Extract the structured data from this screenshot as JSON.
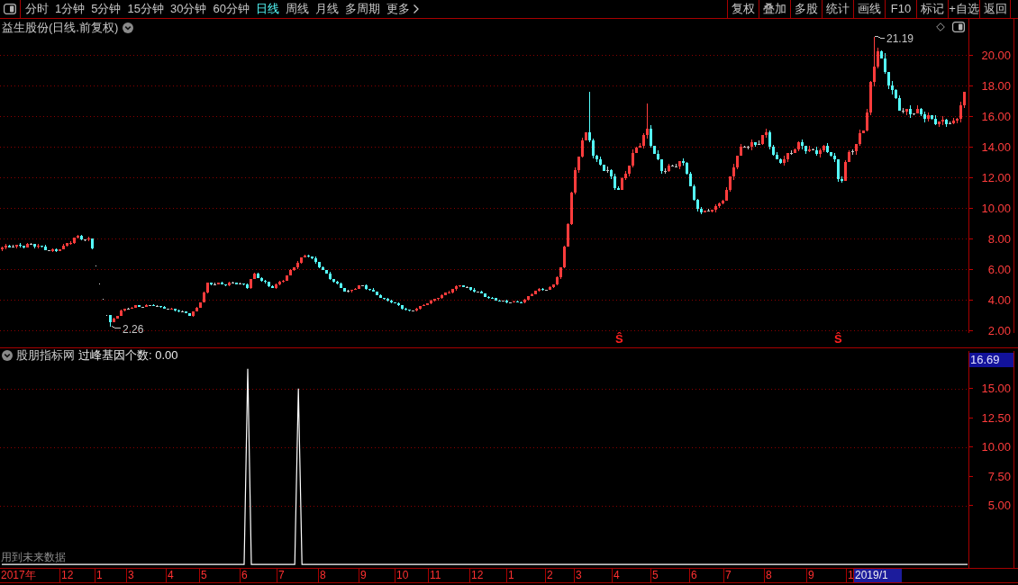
{
  "toolbar": {
    "periods": [
      {
        "label": "分时",
        "selected": false
      },
      {
        "label": "1分钟",
        "selected": false
      },
      {
        "label": "5分钟",
        "selected": false
      },
      {
        "label": "15分钟",
        "selected": false
      },
      {
        "label": "30分钟",
        "selected": false
      },
      {
        "label": "60分钟",
        "selected": false
      },
      {
        "label": "日线",
        "selected": true
      },
      {
        "label": "周线",
        "selected": false
      },
      {
        "label": "月线",
        "selected": false
      },
      {
        "label": "多周期",
        "selected": false
      }
    ],
    "more": "更多",
    "actions": [
      "复权",
      "叠加",
      "多股",
      "统计",
      "画线",
      "F10",
      "标记",
      "+自选",
      "返回"
    ]
  },
  "main_chart": {
    "title": "益生股份(日线.前复权)",
    "price_axis": [
      "20.00",
      "18.00",
      "16.00",
      "14.00",
      "12.00",
      "10.00",
      "8.00",
      "6.00",
      "4.00",
      "2.00"
    ],
    "high_label": "21.19",
    "low_label": "2.26",
    "signals": [
      "Ŝ",
      "Ŝ"
    ]
  },
  "indicator": {
    "source": "股朋指标网",
    "label": "过峰基因个数: 0.00",
    "axis_value": "16.69",
    "note": "用到未来数据",
    "chart_data": {
      "type": "line",
      "categories": [
        null,
        null,
        null,
        null,
        null,
        null,
        null,
        null,
        null,
        null,
        null,
        null,
        null,
        null,
        null,
        null,
        null,
        null,
        null,
        null,
        null,
        null,
        null,
        null,
        null,
        null,
        null,
        null,
        null,
        null,
        null,
        null,
        null,
        null,
        null,
        null,
        null,
        null,
        null,
        null,
        null,
        null,
        null,
        null,
        null,
        null,
        null,
        null,
        null,
        null,
        null,
        null,
        null,
        null,
        null,
        null,
        null,
        null,
        null,
        null,
        null,
        null,
        null,
        null,
        null,
        null,
        null,
        null,
        null,
        null,
        null,
        null,
        null,
        null,
        null,
        null,
        null,
        null,
        null,
        null,
        null,
        null,
        null,
        null,
        null,
        null,
        null,
        null,
        null,
        null,
        null,
        null,
        null,
        null,
        null,
        null,
        null,
        null,
        null,
        null,
        null,
        null,
        null,
        null,
        null,
        null,
        null,
        null,
        null,
        null,
        null,
        null,
        null,
        null,
        null,
        null,
        null,
        null,
        null,
        null,
        null,
        null,
        null,
        null,
        null,
        null,
        null,
        null,
        null,
        null,
        null,
        null,
        null,
        null,
        null,
        null,
        null,
        null,
        null,
        null,
        null,
        null,
        null,
        null,
        null,
        null,
        null,
        null,
        null,
        null,
        null,
        null,
        null,
        null,
        null,
        null,
        null,
        null,
        null,
        null,
        null,
        null,
        null,
        null,
        null,
        null,
        null,
        null,
        null,
        null,
        null,
        null,
        null,
        null,
        null,
        null,
        null,
        null,
        null,
        null,
        null,
        null,
        null,
        null,
        null,
        null,
        null,
        null,
        null,
        null,
        null,
        null,
        null,
        null,
        null,
        null,
        null,
        null,
        null,
        null,
        null,
        null,
        null,
        null,
        null,
        null,
        null,
        null,
        null,
        null,
        null,
        null,
        null,
        null,
        null,
        null,
        null,
        null,
        null,
        null,
        null,
        null,
        null,
        null,
        null,
        null,
        null,
        null,
        null,
        null,
        null,
        null,
        null,
        null,
        null,
        null,
        null,
        null,
        null,
        null,
        null,
        null,
        null,
        null,
        null,
        null,
        null,
        null,
        null,
        null,
        null,
        null,
        null,
        null,
        null,
        null,
        null,
        null,
        null,
        null,
        null,
        null,
        null,
        null,
        null,
        null,
        null,
        null
      ],
      "ylim": [
        -0.3,
        18.2
      ],
      "yticks": [
        {
          "value": 5,
          "label": "5.00"
        },
        {
          "value": 7.5,
          "label": "7.50"
        },
        {
          "value": 10,
          "label": "10.00"
        },
        {
          "value": 12.5,
          "label": "12.50"
        },
        {
          "value": 15,
          "label": "15.00"
        }
      ],
      "grid": true,
      "series": [
        {
          "color": "#ffffff",
          "values": [
            0,
            0,
            0,
            0,
            0,
            0,
            0,
            0,
            0,
            0,
            0,
            0,
            0,
            0,
            0,
            0,
            0,
            0,
            0,
            0,
            0,
            0,
            0,
            0,
            0,
            0,
            0,
            0,
            0,
            0,
            0,
            0,
            0,
            0,
            0,
            0,
            0,
            0,
            0,
            0,
            0,
            0,
            0,
            0,
            0,
            0,
            0,
            0,
            0,
            0,
            0,
            0,
            0,
            0,
            0,
            0,
            0,
            0,
            0,
            0,
            0,
            0,
            0,
            0,
            0,
            0,
            0,
            0,
            16.69,
            0,
            0,
            0,
            0,
            0,
            0,
            0,
            0,
            0,
            0,
            0,
            0,
            0,
            15,
            0,
            0,
            0,
            0,
            0,
            0,
            0,
            0,
            0,
            0,
            0,
            0,
            0,
            0,
            0,
            0,
            0,
            0,
            0,
            0,
            0,
            0,
            0,
            0,
            0,
            0,
            0,
            0,
            0,
            0,
            0,
            0,
            0,
            0,
            0,
            0,
            0,
            0,
            0,
            0,
            0,
            0,
            0,
            0,
            0,
            0,
            0,
            0,
            0,
            0,
            0,
            0,
            0,
            0,
            0,
            0,
            0,
            0,
            0,
            0,
            0,
            0,
            0,
            0,
            0,
            0,
            0,
            0,
            0,
            0,
            0,
            0,
            0,
            0,
            0,
            0,
            0,
            0,
            0,
            0,
            0,
            0,
            0,
            0,
            0,
            0,
            0,
            0,
            0,
            0,
            0,
            0,
            0,
            0,
            0,
            0,
            0,
            0,
            0,
            0,
            0,
            0,
            0,
            0,
            0,
            0,
            0,
            0,
            0,
            0,
            0,
            0,
            0,
            0,
            0,
            0,
            0,
            0,
            0,
            0,
            0,
            0,
            0,
            0,
            0,
            0,
            0,
            0,
            0,
            0,
            0,
            0,
            0,
            0,
            0,
            0,
            0,
            0,
            0,
            0,
            0,
            0,
            0,
            0,
            0,
            0,
            0,
            0,
            0,
            0,
            0,
            0,
            0,
            0,
            0,
            0,
            0,
            0,
            0,
            0,
            0,
            0,
            0,
            0,
            0,
            0,
            0,
            0,
            0,
            0,
            0,
            0,
            0,
            0,
            0,
            0,
            0,
            0,
            0,
            0,
            0,
            0,
            0,
            0,
            0
          ]
        }
      ]
    }
  },
  "time_axis": [
    {
      "label": "2017年",
      "selected": false
    },
    {
      "label": "12",
      "selected": false
    },
    {
      "label": "1",
      "selected": false
    },
    {
      "label": "3",
      "selected": false
    },
    {
      "label": "4",
      "selected": false
    },
    {
      "label": "5",
      "selected": false
    },
    {
      "label": "6",
      "selected": false
    },
    {
      "label": "7",
      "selected": false
    },
    {
      "label": "8",
      "selected": false
    },
    {
      "label": "9",
      "selected": false
    },
    {
      "label": "10",
      "selected": false
    },
    {
      "label": "11",
      "selected": false
    },
    {
      "label": "12",
      "selected": false
    },
    {
      "label": "1",
      "selected": false
    },
    {
      "label": "2",
      "selected": false
    },
    {
      "label": "3",
      "selected": false
    },
    {
      "label": "4",
      "selected": false
    },
    {
      "label": "5",
      "selected": false
    },
    {
      "label": "6",
      "selected": false
    },
    {
      "label": "7",
      "selected": false
    },
    {
      "label": "8",
      "selected": false
    },
    {
      "label": "9",
      "selected": false
    },
    {
      "label": "1",
      "selected": false
    },
    {
      "label": "2019/1",
      "selected": true
    }
  ]
}
